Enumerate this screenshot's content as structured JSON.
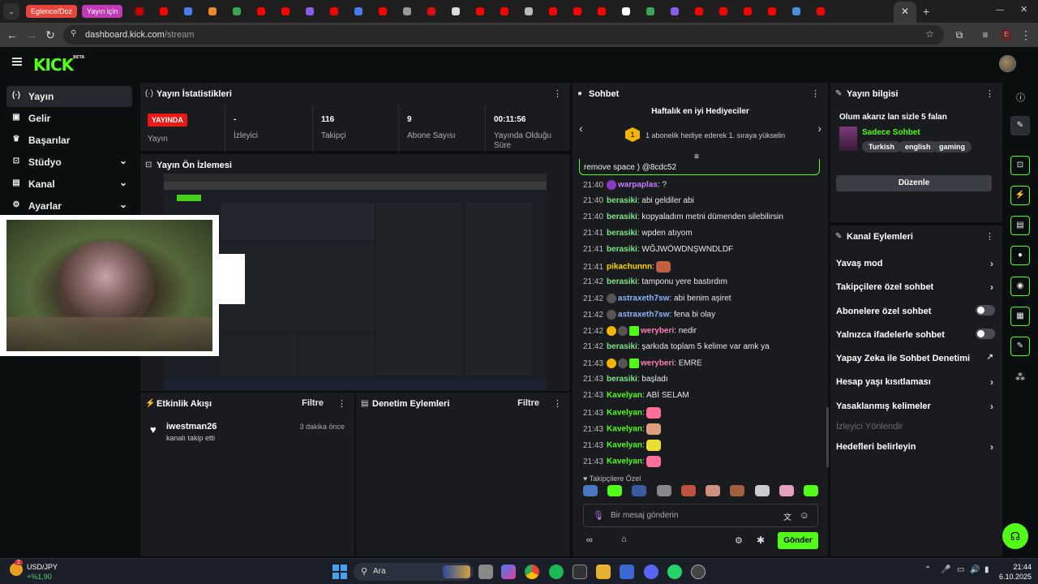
{
  "browser": {
    "tab_groups": [
      {
        "label": "Eglence/Doz",
        "color": "#e8453c"
      },
      {
        "label": "Yayın için",
        "color": "#c13ab5"
      }
    ],
    "url_host": "dashboard.kick.com",
    "url_path": "/stream",
    "profile_initial": "E"
  },
  "kick": {
    "logo_text": "KICK",
    "logo_sup": "BETA"
  },
  "sidebar": {
    "items": [
      {
        "label": "Yayın",
        "icon": "(·)"
      },
      {
        "label": "Gelir",
        "icon": "▣"
      },
      {
        "label": "Başarılar",
        "icon": "♛"
      },
      {
        "label": "Stüdyo",
        "icon": "⊡"
      },
      {
        "label": "Kanal",
        "icon": "▤"
      },
      {
        "label": "Ayarlar",
        "icon": "⚙"
      }
    ]
  },
  "stats": {
    "title": "Yayın İstatistikleri",
    "live_badge": "YAYINDA",
    "live_label": "Yayın",
    "cells": [
      {
        "value": "-",
        "label": "İzleyici"
      },
      {
        "value": "116",
        "label": "Takipçi"
      },
      {
        "value": "9",
        "label": "Abone Sayısı"
      },
      {
        "value": "00:11:56",
        "label": "Yayında Olduğu Süre"
      }
    ]
  },
  "preview": {
    "title": "Yayın Ön İzlemesi"
  },
  "activity": {
    "title": "Etkinlik Akışı",
    "filter": "Filtre",
    "event_user": "iwestman26",
    "event_text": "kanalı takip etti",
    "event_time": "3 dakika önce"
  },
  "moderation": {
    "title": "Denetim Eylemleri",
    "filter": "Filtre"
  },
  "chat": {
    "title": "Sohbet",
    "gifters_title": "Haftalık en iyi Hediyeciler",
    "gifters_rank": "1",
    "gifters_text": "1 abonelik hediye ederek 1. sıraya yükselin",
    "pinned_tail": "remove space ) @8cdc52",
    "messages": [
      {
        "ts": "21:40",
        "user": "warpaplas",
        "color": "#c77dff",
        "text": ": ?"
      },
      {
        "ts": "21:40",
        "user": "berasiki",
        "color": "#7ee787",
        "text": ": abi geldiler abi"
      },
      {
        "ts": "21:40",
        "user": "berasiki",
        "color": "#7ee787",
        "text": ": kopyaladım metni dümenden silebilirsin"
      },
      {
        "ts": "21:41",
        "user": "berasiki",
        "color": "#7ee787",
        "text": ": wpden atıyom"
      },
      {
        "ts": "21:41",
        "user": "berasiki",
        "color": "#7ee787",
        "text": ": WĞJWÖWDNŞWNDLDF"
      },
      {
        "ts": "21:41",
        "user": "pikachunnn",
        "color": "#ffd700",
        "text": ":"
      },
      {
        "ts": "21:42",
        "user": "berasiki",
        "color": "#7ee787",
        "text": ": tamponu yere bastırdım"
      },
      {
        "ts": "21:42",
        "user": "astraxeth7sw",
        "color": "#8fb4ff",
        "text": ": abi benim aşiret"
      },
      {
        "ts": "21:42",
        "user": "astraxeth7sw",
        "color": "#8fb4ff",
        "text": ": fena bi olay"
      },
      {
        "ts": "21:42",
        "user": "weryberi",
        "color": "#ff7eb6",
        "text": ": nedir"
      },
      {
        "ts": "21:42",
        "user": "berasiki",
        "color": "#7ee787",
        "text": ": şarkıda toplam 5 kelime var amk ya"
      },
      {
        "ts": "21:43",
        "user": "weryberi",
        "color": "#ff7eb6",
        "text": ": EMRE"
      },
      {
        "ts": "21:43",
        "user": "berasiki",
        "color": "#7ee787",
        "text": ": başladı"
      },
      {
        "ts": "21:43",
        "user": "Kavelyan",
        "color": "#53fc18",
        "text": ": ABİ SELAM"
      },
      {
        "ts": "21:43",
        "user": "Kavelyan",
        "color": "#53fc18",
        "text": ":"
      },
      {
        "ts": "21:43",
        "user": "Kavelyan",
        "color": "#53fc18",
        "text": ":"
      },
      {
        "ts": "21:43",
        "user": "Kavelyan",
        "color": "#53fc18",
        "text": ":"
      },
      {
        "ts": "21:43",
        "user": "Kavelyan",
        "color": "#53fc18",
        "text": ":"
      }
    ],
    "followers_only": "Takipçilere Özel",
    "input_placeholder": "Bir mesaj gönderin",
    "send_label": "Gönder"
  },
  "stream_info": {
    "title": "Yayın bilgisi",
    "stream_title": "Olum akarız lan sizle 5 falan",
    "category": "Sadece Sohbet",
    "tags": [
      "Turkish",
      "english",
      "gaming"
    ],
    "edit_label": "Düzenle"
  },
  "channel_actions": {
    "title": "Kanal Eylemleri",
    "rows": [
      {
        "label": "Yavaş mod",
        "kind": "arrow"
      },
      {
        "label": "Takipçilere özel sohbet",
        "kind": "arrow"
      },
      {
        "label": "Abonelere özel sohbet",
        "kind": "toggle"
      },
      {
        "label": "Yalnızca ifadelerle sohbet",
        "kind": "toggle"
      },
      {
        "label": "Yapay Zeka ile Sohbet Denetimi",
        "kind": "external"
      },
      {
        "label": "Hesap yaşı kısıtlaması",
        "kind": "arrow"
      },
      {
        "label": "Yasaklanmış kelimeler",
        "kind": "arrow"
      }
    ],
    "disabled_row": "İzleyici Yönlendir",
    "last_row": "Hedefleri belirleyin"
  },
  "taskbar": {
    "ticker_name": "USD/JPY",
    "ticker_change": "+%1,90",
    "ticker_badge": "2",
    "search_label": "Ara",
    "time": "21:44",
    "date": "6.10.2025"
  },
  "colors": {
    "accent": "#53fc18",
    "live": "#e91916",
    "panel": "#191b1f",
    "bg": "#0b0e0f"
  }
}
